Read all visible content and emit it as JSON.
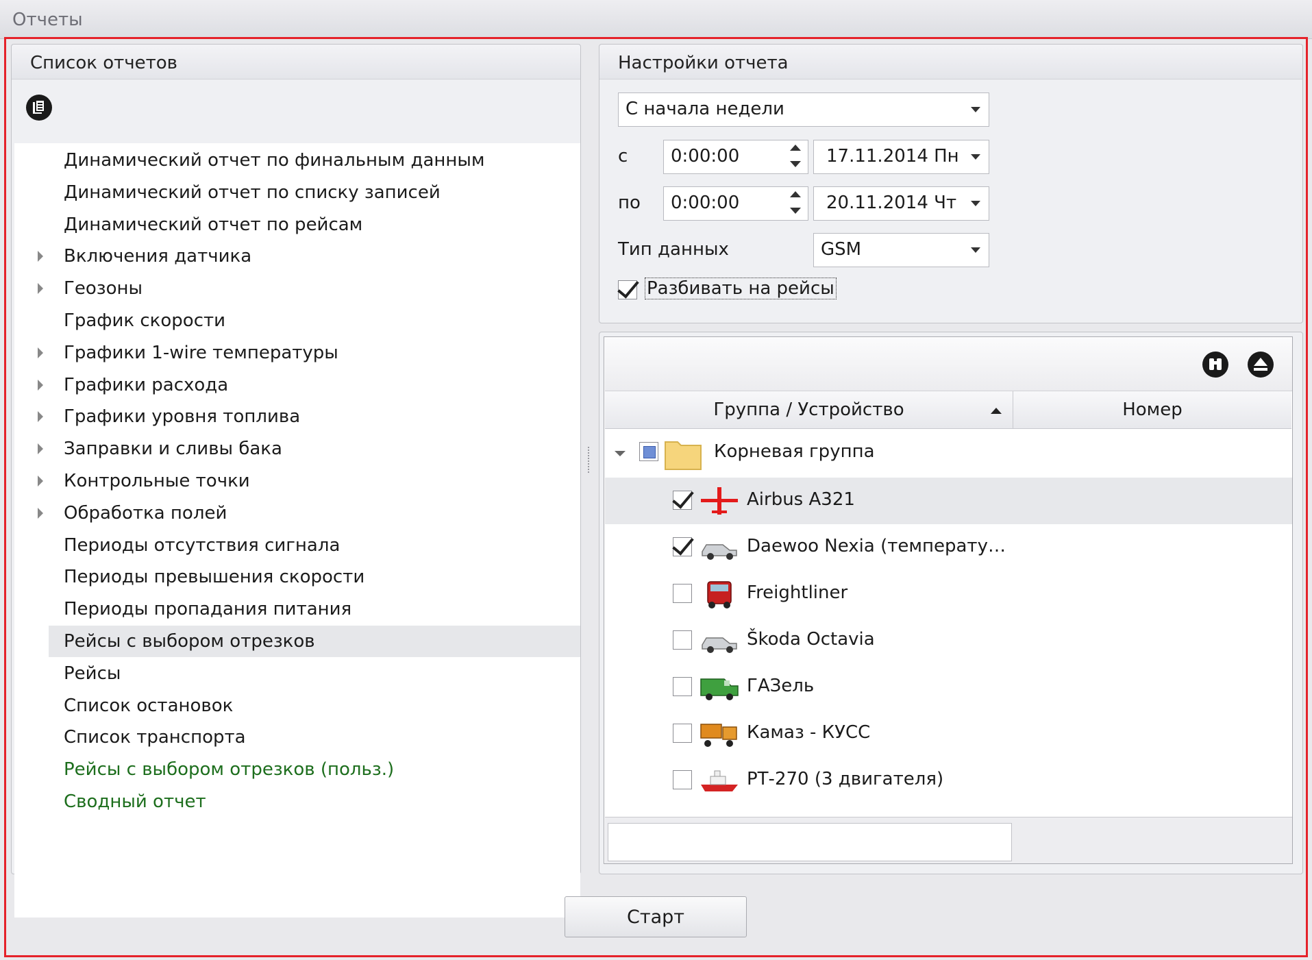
{
  "window": {
    "title": "Отчеты"
  },
  "report_list": {
    "header": "Список отчетов",
    "toolbar_icon": "report-document-icon",
    "items": [
      {
        "label": "Динамический отчет по финальным данным",
        "expandable": false
      },
      {
        "label": "Динамический отчет по списку записей",
        "expandable": false
      },
      {
        "label": "Динамический отчет по рейсам",
        "expandable": false
      },
      {
        "label": "Включения датчика",
        "expandable": true
      },
      {
        "label": "Геозоны",
        "expandable": true
      },
      {
        "label": "График скорости",
        "expandable": false
      },
      {
        "label": "Графики 1-wire температуры",
        "expandable": true
      },
      {
        "label": "Графики расхода",
        "expandable": true
      },
      {
        "label": "Графики уровня топлива",
        "expandable": true
      },
      {
        "label": "Заправки и сливы бака",
        "expandable": true
      },
      {
        "label": "Контрольные точки",
        "expandable": true
      },
      {
        "label": "Обработка полей",
        "expandable": true
      },
      {
        "label": "Периоды отсутствия сигнала",
        "expandable": false
      },
      {
        "label": "Периоды превышения скорости",
        "expandable": false
      },
      {
        "label": "Периоды пропадания питания",
        "expandable": false
      },
      {
        "label": "Рейсы с выбором отрезков",
        "expandable": false,
        "selected": true
      },
      {
        "label": "Рейсы",
        "expandable": false
      },
      {
        "label": "Список остановок",
        "expandable": false
      },
      {
        "label": "Список транспорта",
        "expandable": false
      },
      {
        "label": "Рейсы с выбором отрезков (польз.)",
        "expandable": false,
        "custom": true
      },
      {
        "label": "Сводный отчет",
        "expandable": false,
        "custom": true
      }
    ],
    "custom_color": "#1d6e1d"
  },
  "settings": {
    "header": "Настройки отчета",
    "period_value": "С начала недели",
    "from_label": "с",
    "from_time": "0:00:00",
    "from_date": "17.11.2014 Пн",
    "to_label": "по",
    "to_time": "0:00:00",
    "to_date": "20.11.2014 Чт",
    "data_type_label": "Тип данных",
    "data_type_value": "GSM",
    "split_trips_label": "Разбивать на рейсы",
    "split_trips_checked": true
  },
  "devices": {
    "toolbar_icons": [
      "binoculars-icon",
      "eject-collapse-icon"
    ],
    "columns": {
      "group_device": "Группа / Устройство",
      "number": "Номер"
    },
    "root_group": {
      "label": "Корневая группа",
      "check_state": "partial"
    },
    "rows": [
      {
        "label": "Airbus A321",
        "checked": true,
        "icon": "airplane-icon",
        "selected": true
      },
      {
        "label": "Daewoo Nexia (температу…",
        "checked": true,
        "icon": "car-icon"
      },
      {
        "label": "Freightliner",
        "checked": false,
        "icon": "truck-icon"
      },
      {
        "label": "Škoda Octavia",
        "checked": false,
        "icon": "car-icon"
      },
      {
        "label": "ГАЗель",
        "checked": false,
        "icon": "van-icon"
      },
      {
        "label": "Камаз - КУСС",
        "checked": false,
        "icon": "dump-truck-icon"
      },
      {
        "label": "РТ-270 (3 двигателя)",
        "checked": false,
        "icon": "boat-icon"
      }
    ],
    "search_value": ""
  },
  "actions": {
    "start_label": "Старт"
  },
  "colors": {
    "frame_accent": "#e5222a",
    "selection": "#e6e7ea"
  }
}
